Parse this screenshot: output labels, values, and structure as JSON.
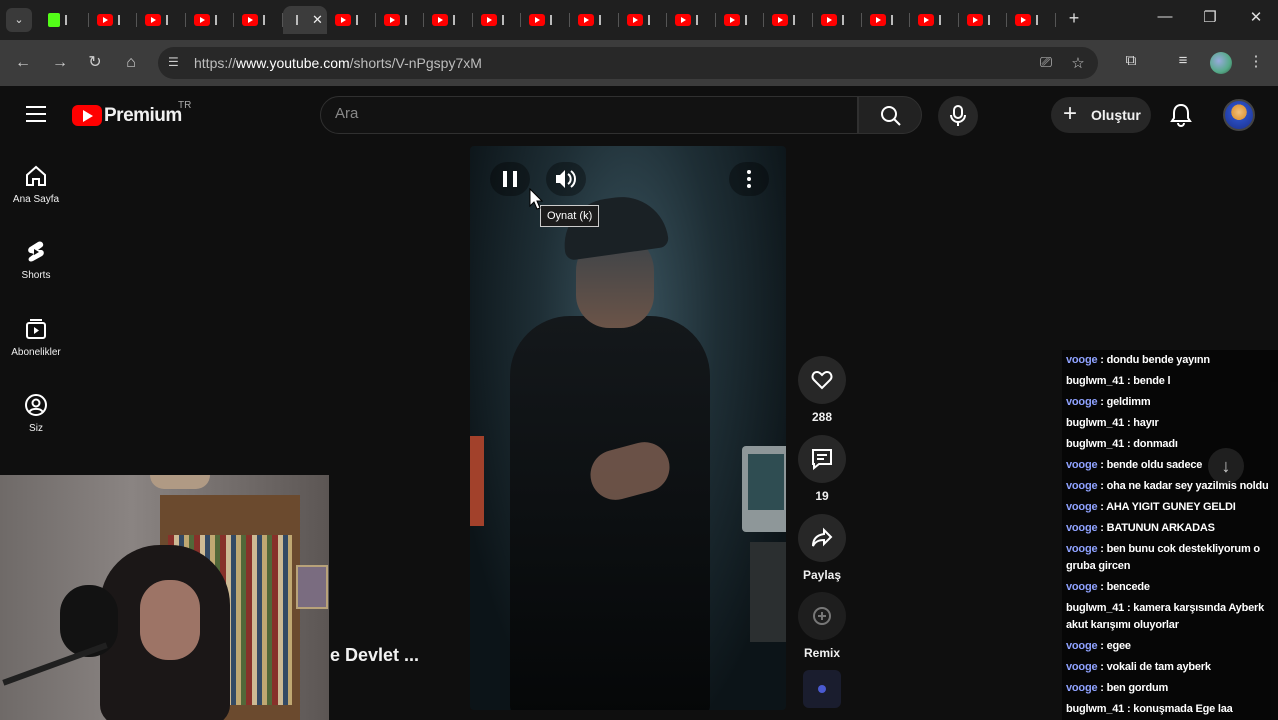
{
  "browser": {
    "tab_count": 21,
    "url_prefix": "https://",
    "url_host": "www.youtube.com",
    "url_path": "/shorts/V-nPgspy7xM"
  },
  "header": {
    "logo_text": "Premium",
    "country_code": "TR",
    "search_placeholder": "Ara",
    "create_label": "Oluştur"
  },
  "sidebar": {
    "items": [
      {
        "label": "Ana Sayfa",
        "icon": "home-icon"
      },
      {
        "label": "Shorts",
        "icon": "shorts-icon"
      },
      {
        "label": "Abonelikler",
        "icon": "subscriptions-icon"
      },
      {
        "label": "Siz",
        "icon": "account-icon"
      }
    ]
  },
  "player": {
    "tooltip": "Oynat (k)"
  },
  "actions": {
    "likes": "288",
    "comments": "19",
    "share_label": "Paylaş",
    "remix_label": "Remix"
  },
  "partial_title": "e Devlet ...",
  "chat": {
    "messages": [
      {
        "user": "vooge",
        "text": " : dondu bende yayınn"
      },
      {
        "user": "buglwm_41",
        "text": " : bende l"
      },
      {
        "user": "vooge",
        "text": " : geldimm"
      },
      {
        "user": "buglwm_41",
        "text": " : hayır"
      },
      {
        "user": "buglwm_41",
        "text": " : donmadı"
      },
      {
        "user": "vooge",
        "text": " : bende oldu sadece"
      },
      {
        "user": "vooge",
        "text": " : oha ne kadar sey yazilmis noldu"
      },
      {
        "user": "vooge",
        "text": " : AHA YIGIT GUNEY GELDI"
      },
      {
        "user": "vooge",
        "text": " : BATUNUN ARKADAS"
      },
      {
        "user": "vooge",
        "text": " : ben bunu cok destekliyorum o gruba gircen"
      },
      {
        "user": "vooge",
        "text": " : bencede"
      },
      {
        "user": "buglwm_41",
        "text": " : kamera karşısında Ayberk akut karışımı oluyorlar"
      },
      {
        "user": "vooge",
        "text": " : egee"
      },
      {
        "user": "vooge",
        "text": " : vokali de tam ayberk"
      },
      {
        "user": "vooge",
        "text": " : ben gordum"
      },
      {
        "user": "buglwm_41",
        "text": " : konuşmada Ege laa"
      }
    ]
  },
  "colors": {
    "brand_red": "#ff0000",
    "chat_user_highlight": "#8fa2ff",
    "background": "#0f0f0f"
  }
}
